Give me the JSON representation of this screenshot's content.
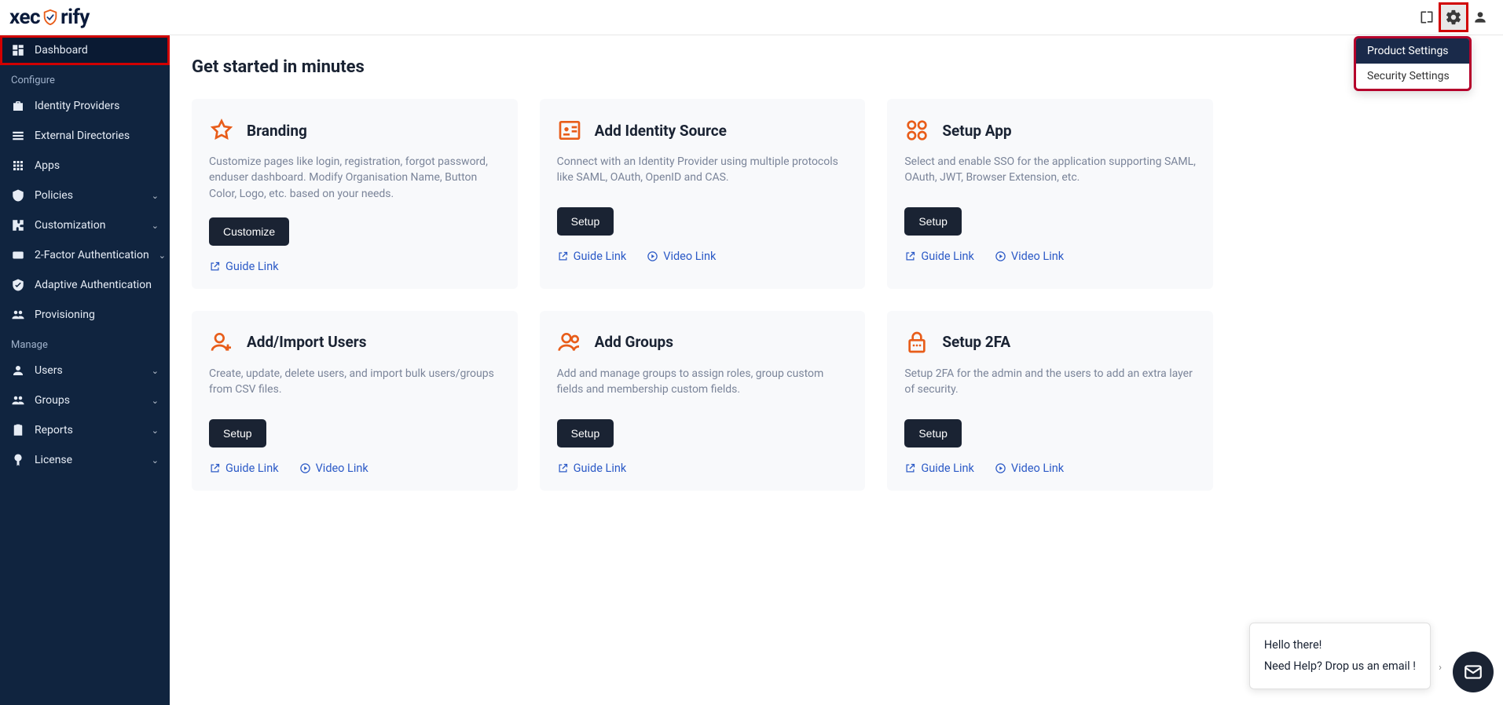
{
  "brand": {
    "name_1": "xec",
    "name_2": "rify"
  },
  "topbar_menu": {
    "product_settings": "Product Settings",
    "security_settings": "Security Settings"
  },
  "sidebar": {
    "dashboard": "Dashboard",
    "section_configure": "Configure",
    "identity_providers": "Identity Providers",
    "external_directories": "External Directories",
    "apps": "Apps",
    "policies": "Policies",
    "customization": "Customization",
    "two_factor": "2-Factor Authentication",
    "adaptive_auth": "Adaptive Authentication",
    "provisioning": "Provisioning",
    "section_manage": "Manage",
    "users": "Users",
    "groups": "Groups",
    "reports": "Reports",
    "license": "License"
  },
  "page": {
    "title": "Get started in minutes"
  },
  "common": {
    "guide_link": "Guide Link",
    "video_link": "Video Link"
  },
  "cards": {
    "branding": {
      "title": "Branding",
      "desc": "Customize pages like login, registration, forgot password, enduser dashboard. Modify Organisation Name, Button Color, Logo, etc. based on your needs.",
      "btn": "Customize"
    },
    "identity_source": {
      "title": "Add Identity Source",
      "desc": "Connect with an Identity Provider using multiple protocols like SAML, OAuth, OpenID and CAS.",
      "btn": "Setup"
    },
    "setup_app": {
      "title": "Setup App",
      "desc": "Select and enable SSO for the application supporting SAML, OAuth, JWT, Browser Extension, etc.",
      "btn": "Setup"
    },
    "add_users": {
      "title": "Add/Import Users",
      "desc": "Create, update, delete users, and import bulk users/groups from CSV files.",
      "btn": "Setup"
    },
    "add_groups": {
      "title": "Add Groups",
      "desc": "Add and manage groups to assign roles, group custom fields and membership custom fields.",
      "btn": "Setup"
    },
    "setup_2fa": {
      "title": "Setup 2FA",
      "desc": "Setup 2FA for the admin and the users to add an extra layer of security.",
      "btn": "Setup"
    }
  },
  "chat": {
    "line1": "Hello there!",
    "line2": "Need Help? Drop us an email !"
  }
}
